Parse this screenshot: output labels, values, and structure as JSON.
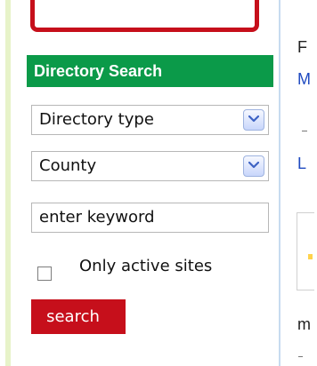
{
  "sidebar": {
    "header": "Directory Search",
    "directory_type": {
      "selected": "Directory type"
    },
    "county": {
      "selected": "County"
    },
    "keyword": {
      "value": "enter keyword"
    },
    "active_sites": {
      "label": "Only active sites",
      "checked": false
    },
    "search_button": "search"
  },
  "content_fragments": {
    "top_letter": "F",
    "blue_letter": "M",
    "link_letter": "L",
    "bottom_letter": "m"
  },
  "colors": {
    "header": "#0b9a49",
    "primary": "#c60f1b",
    "link": "#1f4ac0",
    "sidebar_accent": "#e7f3c9"
  },
  "icons": {
    "dropdown": "chevron-down-icon"
  }
}
